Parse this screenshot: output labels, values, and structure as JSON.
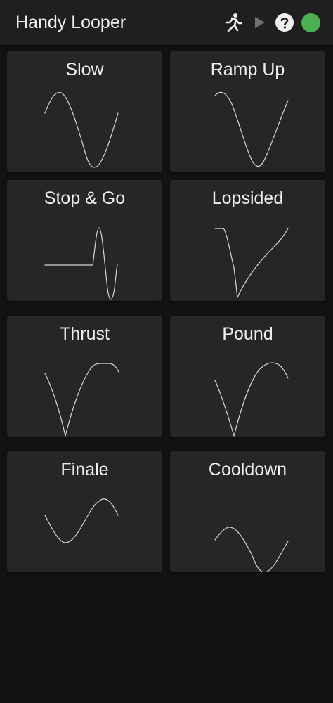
{
  "app": {
    "title": "Handy Looper",
    "status_color": "#4caf50"
  },
  "toolbar": {
    "icons": [
      "runner-icon",
      "play-icon",
      "help-icon",
      "status-dot"
    ]
  },
  "patterns": [
    {
      "label": "Slow"
    },
    {
      "label": "Ramp Up"
    },
    {
      "label": "Stop & Go"
    },
    {
      "label": "Lopsided"
    },
    {
      "label": "Thrust"
    },
    {
      "label": "Pound"
    },
    {
      "label": "Finale"
    },
    {
      "label": "Cooldown"
    }
  ]
}
